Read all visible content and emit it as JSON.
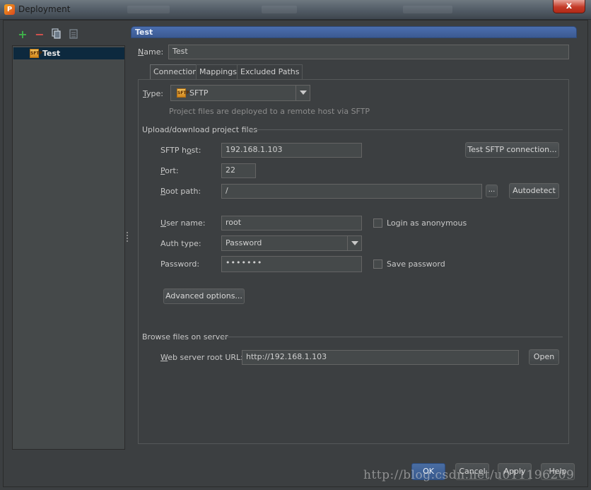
{
  "window": {
    "title": "Deployment",
    "close_glyph": "x"
  },
  "left_toolbar": {
    "add_icon": "plus-icon",
    "remove_icon": "minus-icon",
    "copy_icon": "copy-icon",
    "defaults_icon": "defaults-icon"
  },
  "tree": {
    "items": [
      {
        "label": "Test",
        "icon": "sftp-server-icon"
      }
    ]
  },
  "header": {
    "title": "Test"
  },
  "name_field": {
    "label": "Name:",
    "value": "Test"
  },
  "tabs": [
    {
      "label": "Connection",
      "active": true
    },
    {
      "label": "Mappings",
      "active": false
    },
    {
      "label": "Excluded Paths",
      "active": false
    }
  ],
  "connection": {
    "type_label": "Type:",
    "type_value": "SFTP",
    "type_hint": "Project files are deployed to a remote host via SFTP",
    "upload_section": "Upload/download project files",
    "host_label": "SFTP host:",
    "host_value": "192.168.1.103",
    "test_button": "Test SFTP connection...",
    "port_label": "Port:",
    "port_value": "22",
    "root_path_label": "Root path:",
    "root_path_value": "/",
    "browse_button": "...",
    "autodetect_button": "Autodetect",
    "username_label": "User name:",
    "username_value": "root",
    "anonymous_label": "Login as anonymous",
    "auth_type_label": "Auth type:",
    "auth_type_value": "Password",
    "password_label": "Password:",
    "password_value": "•••••••",
    "save_password_label": "Save password",
    "advanced_button": "Advanced options...",
    "browse_section": "Browse files on server",
    "web_url_label": "Web server root URL:",
    "web_url_value": "http://192.168.1.103",
    "open_button": "Open"
  },
  "footer": {
    "ok": "OK",
    "cancel": "Cancel",
    "apply": "Apply",
    "help": "Help",
    "watermark": "http://blog.csdn.net/u011196209"
  },
  "colors": {
    "background": "#3c3f41",
    "header_blue": "#4b6eaf",
    "selection": "#0d293e",
    "add_green": "#3fb14a",
    "remove_red": "#d9534f"
  }
}
